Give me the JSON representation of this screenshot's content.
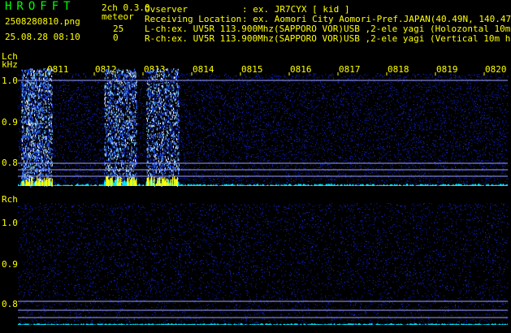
{
  "header": {
    "app_title": "HROFFT",
    "version": "2ch 0.3.0",
    "filename": "2508280810.png",
    "meteor_label": "meteor",
    "meteor_count_l": "25",
    "meteor_count_r": "0",
    "datetime": "25.08.28 08:10",
    "observer_label": "Ovserver",
    "observer_value": ": ex. JR7CYX [ kid ]",
    "location_label": "Receiving Location",
    "location_value": ": ex. Aomori City Aomori-Pref.JAPAN(40.49N, 140.47E)",
    "lch_info": "L-ch:ex. UV5R 113.900Mhz(SAPPORO VOR)USB ,2-ele yagi (Holozontal 10m height)",
    "rch_info": "R-ch:ex. UV5R 113.900Mhz(SAPPORO VOR)USB ,2-ele yagi (Vertical 10m height)"
  },
  "lch": {
    "label": "Lch",
    "unit": "kHz",
    "y_ticks": [
      "1.0",
      "0.9",
      "0.8"
    ],
    "bursts": [
      {
        "minute": "0810",
        "strength": 0.9
      },
      {
        "minute": "0812",
        "strength": 0.75
      },
      {
        "minute": "0813",
        "strength": 0.7
      }
    ]
  },
  "rch": {
    "label": "Rch",
    "y_ticks": [
      "1.0",
      "0.9",
      "0.8"
    ]
  },
  "time_axis": {
    "labels": [
      "0811",
      "0812",
      "0813",
      "0814",
      "0815",
      "0816",
      "0817",
      "0818",
      "0819",
      "0820"
    ]
  },
  "colors": {
    "background": "#000000",
    "text_green": "#00ff00",
    "text_yellow": "#ffff00",
    "noise_blue": "#0a1aa0",
    "signal_cyan": "#00e5ff",
    "signal_yellow": "#ffff00",
    "guide_lines": "#9aa0ff"
  }
}
